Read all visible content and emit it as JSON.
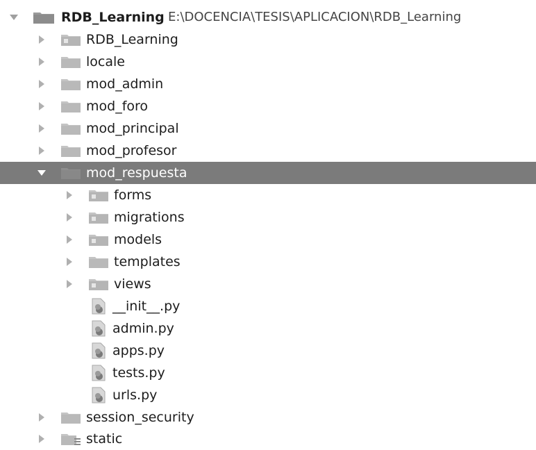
{
  "project_tree": {
    "root": {
      "label": "RDB_Learning",
      "path": "E:\\DOCENCIA\\TESIS\\APLICACION\\RDB_Learning"
    },
    "items": [
      {
        "label": "RDB_Learning",
        "kind": "package-folder",
        "expanded": false
      },
      {
        "label": "locale",
        "kind": "folder",
        "expanded": false
      },
      {
        "label": "mod_admin",
        "kind": "folder",
        "expanded": false
      },
      {
        "label": "mod_foro",
        "kind": "folder",
        "expanded": false
      },
      {
        "label": "mod_principal",
        "kind": "folder",
        "expanded": false
      },
      {
        "label": "mod_profesor",
        "kind": "folder",
        "expanded": false
      },
      {
        "label": "mod_respuesta",
        "kind": "folder",
        "expanded": true,
        "selected": true,
        "children": [
          {
            "label": "forms",
            "kind": "package-folder",
            "expanded": false
          },
          {
            "label": "migrations",
            "kind": "package-folder",
            "expanded": false
          },
          {
            "label": "models",
            "kind": "package-folder",
            "expanded": false
          },
          {
            "label": "templates",
            "kind": "folder",
            "expanded": false
          },
          {
            "label": "views",
            "kind": "package-folder",
            "expanded": false
          },
          {
            "label": "__init__.py",
            "kind": "python-file"
          },
          {
            "label": "admin.py",
            "kind": "python-file"
          },
          {
            "label": "apps.py",
            "kind": "python-file"
          },
          {
            "label": "tests.py",
            "kind": "python-file"
          },
          {
            "label": "urls.py",
            "kind": "python-file"
          }
        ]
      },
      {
        "label": "session_security",
        "kind": "folder",
        "expanded": false
      },
      {
        "label": "static",
        "kind": "resource-folder",
        "expanded": false
      }
    ]
  },
  "colors": {
    "selection_background": "#7b7b7b",
    "folder_gray": "#b9b9b9",
    "arrow_gray": "#a0a0a0",
    "text": "#1c1c1c"
  }
}
